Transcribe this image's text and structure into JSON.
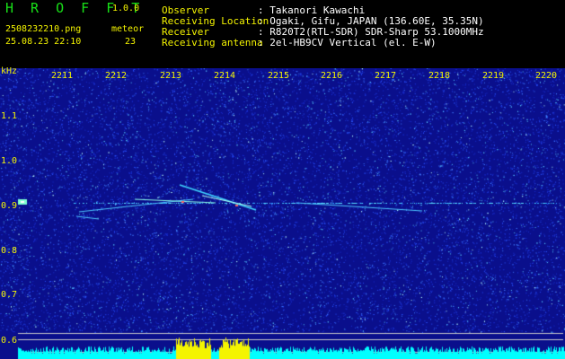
{
  "app": {
    "logo": "H R O F F T",
    "version": "1.0.0"
  },
  "file": {
    "name": "2508232210.png",
    "datetime": "25.08.23 22:10"
  },
  "detector": {
    "label": "meteor",
    "count": "23"
  },
  "info": [
    {
      "label": "Observer",
      "value": ": Takanori Kawachi"
    },
    {
      "label": "Receiving Location",
      "value": ": Ogaki, Gifu, JAPAN (136.60E, 35.35N)"
    },
    {
      "label": "Receiver",
      "value": ": R820T2(RTL-SDR) SDR-Sharp 53.1000MHz"
    },
    {
      "label": "Receiving antenna",
      "value": ": 2el-HB9CV Vertical (el. E-W)"
    }
  ],
  "axis": {
    "y_unit": "kHz",
    "x_ticks": [
      "2211",
      "2212",
      "2213",
      "2214",
      "2215",
      "2216",
      "2217",
      "2218",
      "2219",
      "2220"
    ],
    "y_ticks": [
      "1.1",
      "1.0",
      "0.9",
      "0.8",
      "0.7",
      "0.6"
    ]
  },
  "colors": {
    "background": "#0a0f8c",
    "signal": "#00ffff",
    "label": "#f4f400",
    "logo": "#18e018"
  }
}
